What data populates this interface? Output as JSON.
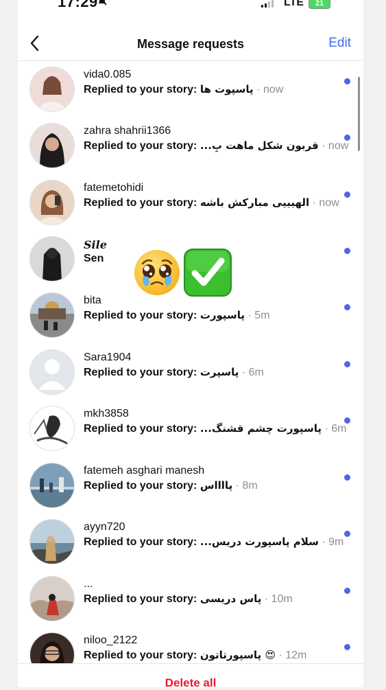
{
  "status": {
    "time": "17:29",
    "network": "LTE",
    "battery": "21"
  },
  "header": {
    "title": "Message requests",
    "edit_label": "Edit"
  },
  "colors": {
    "accent": "#3d6ef5",
    "unread_dot": "#4a68e8",
    "danger": "#e8182c",
    "meta_gray": "#8e8e8e"
  },
  "requests": [
    {
      "username": "vida0.085",
      "prefix": "Replied to your story:",
      "message": "پاسپوت ها",
      "time": "now"
    },
    {
      "username": "zahra shahrii1366",
      "prefix": "Replied to your story:",
      "message": "قربون شکل ماهت بِ...",
      "time": "now"
    },
    {
      "username": "fatemetohidi",
      "prefix": "Replied to your story:",
      "message": "الهیییی مبارکش باشه",
      "time": "now"
    },
    {
      "username": "Sile",
      "prefix": "Sen",
      "message": "",
      "time": ""
    },
    {
      "username": "bita",
      "prefix": "Replied to your story:",
      "message": "پاسپورت",
      "time": "5m"
    },
    {
      "username": "Sara1904",
      "prefix": "Replied to your story:",
      "message": "پاسپرت",
      "time": "6m"
    },
    {
      "username": "mkh3858",
      "prefix": "Replied to your story:",
      "message": "پاسپورت چشم قشنگ...",
      "time": "6m"
    },
    {
      "username": "fatemeh asghari manesh",
      "prefix": "Replied to your story:",
      "message": "پااااس",
      "time": "8m"
    },
    {
      "username": "ayyn720",
      "prefix": "Replied to your story:",
      "message": "سلام پاسپورت دریس...",
      "time": "9m"
    },
    {
      "username": "...",
      "prefix": "Replied to your story:",
      "message": "پاس دریسی",
      "time": "10m"
    },
    {
      "username": "niloo_2122",
      "prefix": "Replied to your story:",
      "message": "😍 پاسپورتاتون",
      "time": "12m"
    }
  ],
  "stickers": {
    "face": "pleading-face-icon",
    "check": "check-mark-button-icon"
  },
  "footer": {
    "delete_label": "Delete all"
  }
}
